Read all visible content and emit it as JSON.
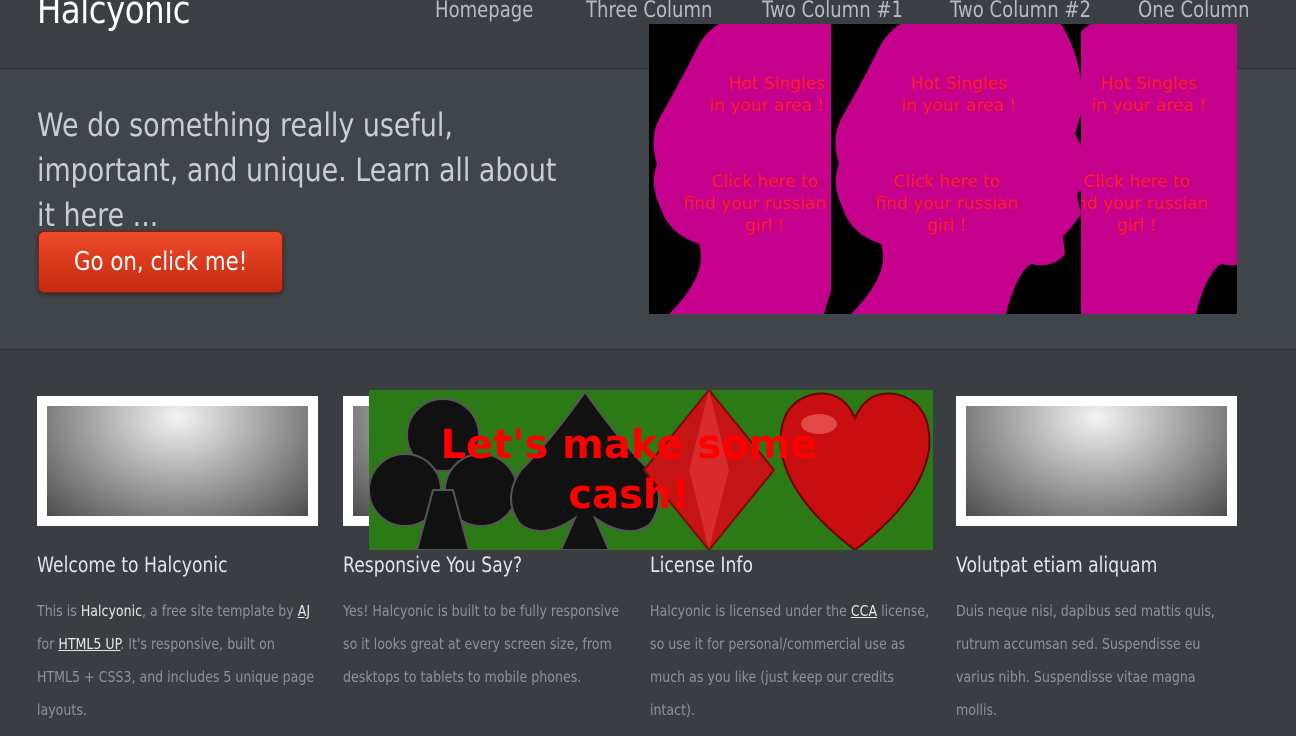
{
  "header": {
    "logo": "Halcyonic",
    "nav": [
      "Homepage",
      "Three Column",
      "Two Column #1",
      "Two Column #2",
      "One Column"
    ]
  },
  "banner": {
    "headline": "We do something really useful, important, and unique. Learn all about it here ...",
    "cta_label": "Go on, click me!"
  },
  "ad_top": {
    "line1": "Hot Singles",
    "line2": "in your area !",
    "line3": "Click here to",
    "line4": "find your russian",
    "line5": "girl !",
    "colors": {
      "silhouette": "#c4008c",
      "text": "#ff2020",
      "bg": "#000000"
    }
  },
  "ad_mid": {
    "title_line1": "Let's make some",
    "title_line2": "cash!",
    "colors": {
      "bg": "#2c7a16",
      "text": "#ff0000"
    }
  },
  "columns": [
    {
      "title": "Welcome to Halcyonic",
      "t1": "This is ",
      "strong": "Halcyonic",
      "t2": ", a free site template by ",
      "link1": "AJ",
      "t3": " for",
      "link2": "HTML5 UP",
      "t4": ". It's responsive, built on HTML5 + CSS3, and includes 5 unique page layouts."
    },
    {
      "title": "Responsive You Say?",
      "text": "Yes! Halcyonic is built to be fully responsive so it looks great at every screen size, from desktops to tablets to mobile phones."
    },
    {
      "title": "License Info",
      "t1": "Halcyonic is licensed under the ",
      "link1": "CCA",
      "t2": " license, so use it for personal/commercial use as much as you like (just keep our credits intact)."
    },
    {
      "title": "Volutpat etiam aliquam",
      "text": "Duis neque nisi, dapibus sed mattis quis, rutrum accumsan sed. Suspendisse eu varius nibh. Suspendisse vitae magna mollis."
    }
  ]
}
